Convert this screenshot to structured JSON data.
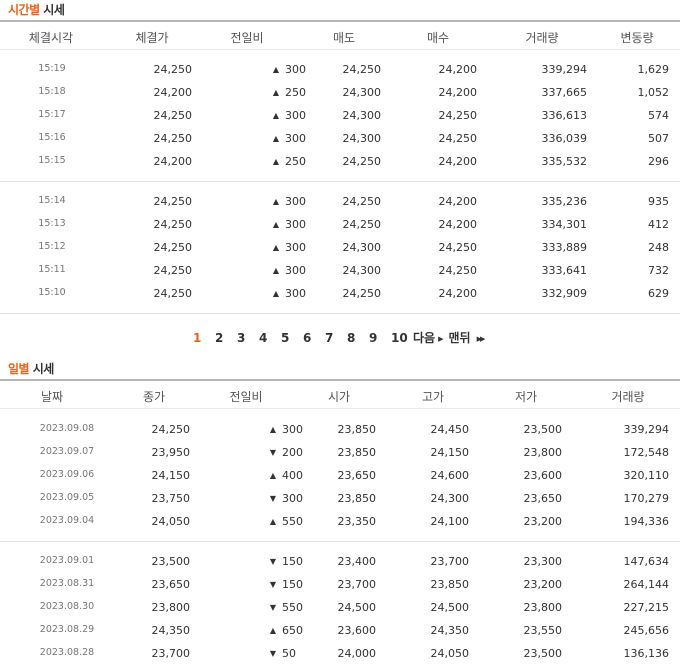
{
  "time_section": {
    "title_accent": "시간별",
    "title_rest": " 시세",
    "headers": [
      "체결시각",
      "체결가",
      "전일비",
      "매도",
      "매수",
      "거래량",
      "변동량"
    ],
    "groups": [
      [
        {
          "time": "15:19",
          "price": "24,250",
          "dir": "up",
          "change": "300",
          "ask": "24,250",
          "bid": "24,200",
          "volume": "339,294",
          "delta": "1,629"
        },
        {
          "time": "15:18",
          "price": "24,200",
          "dir": "up",
          "change": "250",
          "ask": "24,300",
          "bid": "24,200",
          "volume": "337,665",
          "delta": "1,052"
        },
        {
          "time": "15:17",
          "price": "24,250",
          "dir": "up",
          "change": "300",
          "ask": "24,300",
          "bid": "24,250",
          "volume": "336,613",
          "delta": "574"
        },
        {
          "time": "15:16",
          "price": "24,250",
          "dir": "up",
          "change": "300",
          "ask": "24,300",
          "bid": "24,250",
          "volume": "336,039",
          "delta": "507"
        },
        {
          "time": "15:15",
          "price": "24,200",
          "dir": "up",
          "change": "250",
          "ask": "24,250",
          "bid": "24,200",
          "volume": "335,532",
          "delta": "296"
        }
      ],
      [
        {
          "time": "15:14",
          "price": "24,250",
          "dir": "up",
          "change": "300",
          "ask": "24,250",
          "bid": "24,200",
          "volume": "335,236",
          "delta": "935"
        },
        {
          "time": "15:13",
          "price": "24,250",
          "dir": "up",
          "change": "300",
          "ask": "24,250",
          "bid": "24,200",
          "volume": "334,301",
          "delta": "412"
        },
        {
          "time": "15:12",
          "price": "24,250",
          "dir": "up",
          "change": "300",
          "ask": "24,300",
          "bid": "24,250",
          "volume": "333,889",
          "delta": "248"
        },
        {
          "time": "15:11",
          "price": "24,250",
          "dir": "up",
          "change": "300",
          "ask": "24,300",
          "bid": "24,250",
          "volume": "333,641",
          "delta": "732"
        },
        {
          "time": "15:10",
          "price": "24,250",
          "dir": "up",
          "change": "300",
          "ask": "24,250",
          "bid": "24,200",
          "volume": "332,909",
          "delta": "629"
        }
      ]
    ]
  },
  "pagination": {
    "pages": [
      "1",
      "2",
      "3",
      "4",
      "5",
      "6",
      "7",
      "8",
      "9",
      "10"
    ],
    "active_page": "1",
    "next_label": "다음",
    "last_label": "맨뒤",
    "next_icon": "right-triangle-icon",
    "last_icon": "double-right-triangle-icon"
  },
  "daily_section": {
    "title_accent": "일별",
    "title_rest": " 시세",
    "headers": [
      "날짜",
      "종가",
      "전일비",
      "시가",
      "고가",
      "저가",
      "거래량"
    ],
    "groups": [
      [
        {
          "date": "2023.09.08",
          "close": "24,250",
          "dir": "up",
          "change": "300",
          "open": "23,850",
          "high": "24,450",
          "low": "23,500",
          "volume": "339,294"
        },
        {
          "date": "2023.09.07",
          "close": "23,950",
          "dir": "down",
          "change": "200",
          "open": "23,850",
          "high": "24,150",
          "low": "23,800",
          "volume": "172,548"
        },
        {
          "date": "2023.09.06",
          "close": "24,150",
          "dir": "up",
          "change": "400",
          "open": "23,650",
          "high": "24,600",
          "low": "23,600",
          "volume": "320,110"
        },
        {
          "date": "2023.09.05",
          "close": "23,750",
          "dir": "down",
          "change": "300",
          "open": "23,850",
          "high": "24,300",
          "low": "23,650",
          "volume": "170,279"
        },
        {
          "date": "2023.09.04",
          "close": "24,050",
          "dir": "up",
          "change": "550",
          "open": "23,350",
          "high": "24,100",
          "low": "23,200",
          "volume": "194,336"
        }
      ],
      [
        {
          "date": "2023.09.01",
          "close": "23,500",
          "dir": "down",
          "change": "150",
          "open": "23,400",
          "high": "23,700",
          "low": "23,300",
          "volume": "147,634"
        },
        {
          "date": "2023.08.31",
          "close": "23,650",
          "dir": "down",
          "change": "150",
          "open": "23,700",
          "high": "23,850",
          "low": "23,200",
          "volume": "264,144"
        },
        {
          "date": "2023.08.30",
          "close": "23,800",
          "dir": "down",
          "change": "550",
          "open": "24,500",
          "high": "24,500",
          "low": "23,800",
          "volume": "227,215"
        },
        {
          "date": "2023.08.29",
          "close": "24,350",
          "dir": "up",
          "change": "650",
          "open": "23,600",
          "high": "24,350",
          "low": "23,550",
          "volume": "245,656"
        },
        {
          "date": "2023.08.28",
          "close": "23,700",
          "dir": "down",
          "change": "50",
          "open": "24,000",
          "high": "24,050",
          "low": "23,500",
          "volume": "136,136"
        }
      ]
    ]
  },
  "colors": {
    "accent": "#e8621a",
    "up": "#d60000",
    "down": "#1060d0"
  }
}
